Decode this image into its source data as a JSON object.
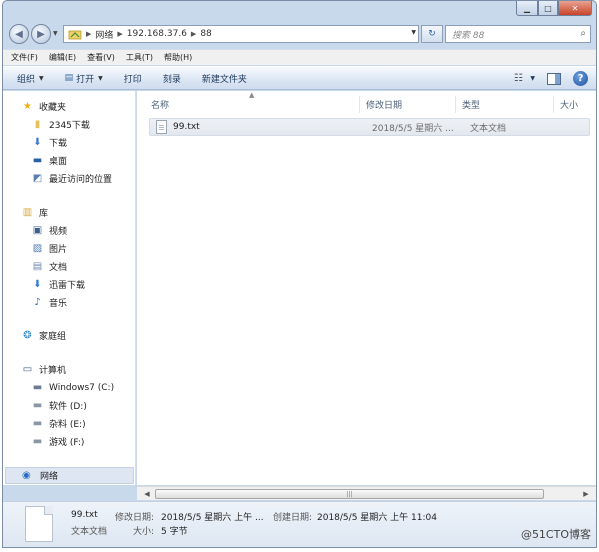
{
  "caption": {
    "minimize_icon": "minimize-icon",
    "maximize_icon": "maximize-icon",
    "close_icon": "close-icon"
  },
  "address": {
    "segments": [
      "网络",
      "192.168.37.6",
      "88"
    ],
    "search_placeholder": "搜索 88"
  },
  "menu": [
    "文件(F)",
    "编辑(E)",
    "查看(V)",
    "工具(T)",
    "帮助(H)"
  ],
  "commands": {
    "organize": "组织",
    "open": "打开",
    "print": "打印",
    "burn": "刻录",
    "new_folder": "新建文件夹"
  },
  "nav": {
    "favorites": {
      "label": "收藏夹",
      "items": [
        "2345下载",
        "下载",
        "桌面",
        "最近访问的位置"
      ]
    },
    "libraries": {
      "label": "库",
      "items": [
        "视频",
        "图片",
        "文档",
        "迅雷下载",
        "音乐"
      ]
    },
    "homegroup": "家庭组",
    "computer": {
      "label": "计算机",
      "items": [
        "Windows7 (C:)",
        "软件 (D:)",
        "杂料 (E:)",
        "游戏 (F:)"
      ]
    },
    "network": "网络"
  },
  "columns": {
    "name": "名称",
    "date": "修改日期",
    "type": "类型",
    "size": "大小"
  },
  "files": [
    {
      "name": "99.txt",
      "date": "2018/5/5 星期六 ...",
      "type": "文本文档"
    }
  ],
  "details": {
    "name": "99.txt",
    "type": "文本文档",
    "modified_label": "修改日期:",
    "modified_value": "2018/5/5 星期六 上午 ...",
    "size_label": "大小:",
    "size_value": "5 字节",
    "created_label": "创建日期:",
    "created_value": "2018/5/5 星期六 上午 11:04"
  },
  "watermark": "@51CTO博客"
}
